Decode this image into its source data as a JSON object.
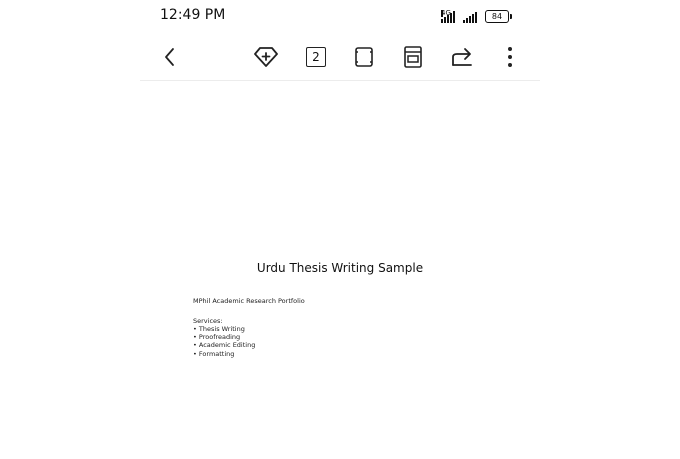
{
  "status_bar": {
    "time": "12:49 PM",
    "network_label": "4G",
    "battery_level": "84"
  },
  "toolbar": {
    "page_count": "2"
  },
  "document": {
    "title": "Urdu Thesis Writing Sample",
    "subtitle": "MPhil Academic Research Portfolio",
    "services_heading": "Services:",
    "services": [
      "Thesis Writing",
      "Proofreading",
      "Academic Editing",
      "Formatting"
    ]
  }
}
